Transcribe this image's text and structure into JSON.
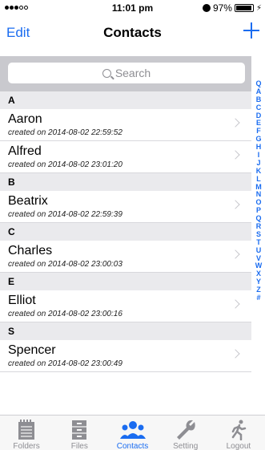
{
  "status_bar": {
    "time": "11:01 pm",
    "battery_text": "97%",
    "battery_level": 0.97,
    "signal_total": 5,
    "signal_filled": 3
  },
  "nav": {
    "edit_label": "Edit",
    "title": "Contacts",
    "add_icon": "plus-icon"
  },
  "search": {
    "placeholder": "Search"
  },
  "sections": [
    {
      "letter": "A",
      "rows": [
        {
          "name": "Aaron",
          "created": "created on 2014-08-02 22:59:52"
        },
        {
          "name": "Alfred",
          "created": "created on 2014-08-02 23:01:20"
        }
      ]
    },
    {
      "letter": "B",
      "rows": [
        {
          "name": "Beatrix",
          "created": "created on 2014-08-02 22:59:39"
        }
      ]
    },
    {
      "letter": "C",
      "rows": [
        {
          "name": "Charles",
          "created": "created on 2014-08-02 23:00:03"
        }
      ]
    },
    {
      "letter": "E",
      "rows": [
        {
          "name": "Elliot",
          "created": "created on 2014-08-02 23:00:16"
        }
      ]
    },
    {
      "letter": "S",
      "rows": [
        {
          "name": "Spencer",
          "created": "created on 2014-08-02 23:00:49"
        }
      ]
    }
  ],
  "index": [
    "Q",
    "A",
    "B",
    "C",
    "D",
    "E",
    "F",
    "G",
    "H",
    "I",
    "J",
    "K",
    "L",
    "M",
    "N",
    "O",
    "P",
    "Q",
    "R",
    "S",
    "T",
    "U",
    "V",
    "W",
    "X",
    "Y",
    "Z",
    "#"
  ],
  "tabs": [
    {
      "label": "Folders",
      "icon": "notepad-icon",
      "active": false
    },
    {
      "label": "Files",
      "icon": "file-cabinet-icon",
      "active": false
    },
    {
      "label": "Contacts",
      "icon": "people-icon",
      "active": true
    },
    {
      "label": "Setting",
      "icon": "wrench-icon",
      "active": false
    },
    {
      "label": "Logout",
      "icon": "running-man-icon",
      "active": false
    }
  ],
  "colors": {
    "accent": "#1a6cf0",
    "inactive": "#8e8e93"
  }
}
